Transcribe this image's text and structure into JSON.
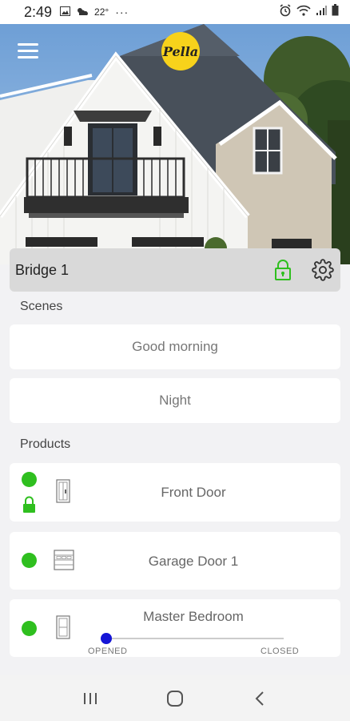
{
  "status_bar": {
    "time": "2:49",
    "temperature": "22°",
    "overflow": "···",
    "icons": [
      "image-icon",
      "weather-icon",
      "alarm-icon",
      "wifi-icon",
      "signal-icon",
      "battery-icon"
    ]
  },
  "header": {
    "brand": "Pella",
    "brand_color": "#f7d21b",
    "menu_icon": "hamburger-menu-icon"
  },
  "bridge": {
    "name": "Bridge 1",
    "lock_icon": "lock-icon",
    "lock_color": "#2fbf1f",
    "settings_icon": "gear-icon"
  },
  "scenes": {
    "label": "Scenes",
    "items": [
      {
        "label": "Good morning"
      },
      {
        "label": "Night"
      }
    ]
  },
  "products": {
    "label": "Products",
    "status_color": "#2fbf1f",
    "items": [
      {
        "name": "Front Door",
        "icon": "door-icon",
        "status": "online",
        "locked": true
      },
      {
        "name": "Garage Door 1",
        "icon": "garage-door-icon",
        "status": "online"
      },
      {
        "name": "Master Bedroom",
        "icon": "window-icon",
        "status": "online",
        "shade_position": 0,
        "open_label": "OPENED",
        "closed_label": "CLOSED"
      }
    ]
  },
  "nav_bar": {
    "icons": [
      "recent-apps-icon",
      "home-icon",
      "back-icon"
    ]
  }
}
